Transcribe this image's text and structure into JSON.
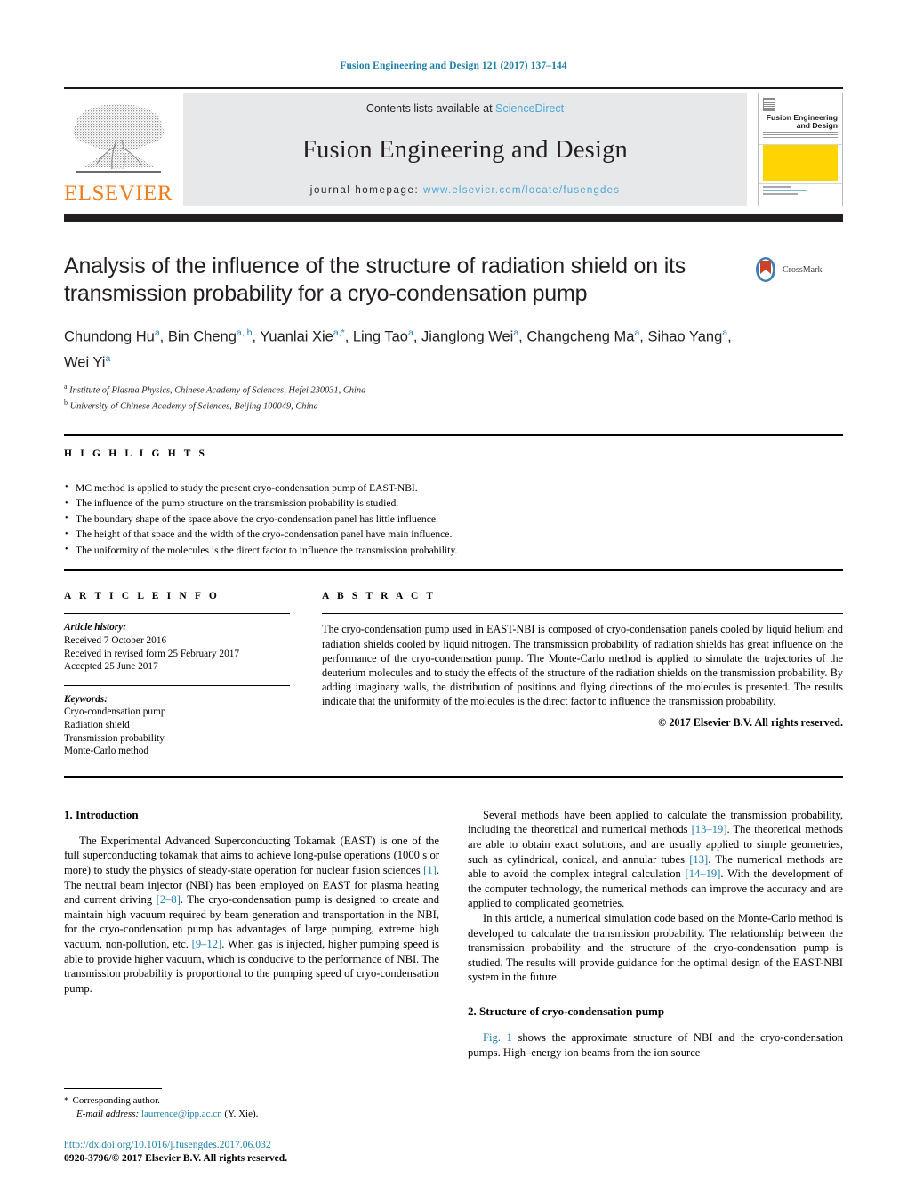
{
  "running_head": "Fusion Engineering and Design 121 (2017) 137–144",
  "masthead": {
    "publisher_logo_text": "ELSEVIER",
    "contents_prefix": "Contents lists available at ",
    "contents_link": "ScienceDirect",
    "journal_title": "Fusion Engineering and Design",
    "homepage_prefix": "journal homepage: ",
    "homepage_url": "www.elsevier.com/locate/fusengdes",
    "cover": {
      "line1": "Fusion Engineering",
      "line2": "and Design"
    },
    "accent_color": "#4aa7d8",
    "elsevier_orange": "#f07c1b",
    "band_gray": "#e7e8ea",
    "cover_yellow": "#ffd400"
  },
  "title": "Analysis of the influence of the structure of radiation shield on its transmission probability for a cryo-condensation pump",
  "crossmark_label": "CrossMark",
  "authors": "Chundong Hu<sup>a</sup>, Bin Cheng<sup>a, b</sup>, Yuanlai Xie<sup>a,*</sup>, Ling Tao<sup>a</sup>, Jianglong Wei<sup>a</sup>, Changcheng Ma<sup>a</sup>, Sihao Yang<sup>a</sup>, Wei Yi<sup>a</sup>",
  "affiliations": [
    "<sup>a</sup> Institute of Plasma Physics, Chinese Academy of Sciences, Hefei 230031, China",
    "<sup>b</sup> University of Chinese Academy of Sciences, Beijing 100049, China"
  ],
  "highlights": {
    "heading": "H I G H L I G H T S",
    "items": [
      "MC method is applied to study the present cryo-condensation pump of EAST-NBI.",
      "The influence of the pump structure on the transmission probability is studied.",
      "The boundary shape of the space above the cryo-condensation panel has little influence.",
      "The height of that space and the width of the cryo-condensation panel have main influence.",
      "The uniformity of the molecules is the direct factor to influence the transmission probability."
    ]
  },
  "article_info": {
    "heading": "A R T I C L E   I N F O",
    "history_label": "Article history:",
    "history": [
      "Received 7 October 2016",
      "Received in revised form 25 February 2017",
      "Accepted 25 June 2017"
    ],
    "keywords_label": "Keywords:",
    "keywords": [
      "Cryo-condensation pump",
      "Radiation shield",
      "Transmission probability",
      "Monte-Carlo method"
    ]
  },
  "abstract": {
    "heading": "A B S T R A C T",
    "text": "The cryo-condensation pump used in EAST-NBI is composed of cryo-condensation panels cooled by liquid helium and radiation shields cooled by liquid nitrogen. The transmission probability of radiation shields has great influence on the performance of the cryo-condensation pump. The Monte-Carlo method is applied to simulate the trajectories of the deuterium molecules and to study the effects of the structure of the radiation shields on the transmission probability. By adding imaginary walls, the distribution of positions and flying directions of the molecules is presented. The results indicate that the uniformity of the molecules is the direct factor to influence the transmission probability.",
    "copyright": "© 2017 Elsevier B.V. All rights reserved."
  },
  "sections": {
    "intro_heading": "1. Introduction",
    "intro_p1": "The Experimental Advanced Superconducting Tokamak (EAST) is one of the full superconducting tokamak that aims to achieve long-pulse operations (1000 s or more) to study the physics of steady-state operation for nuclear fusion sciences <span class=\"ref\">[1]</span>. The neutral beam injector (NBI) has been employed on EAST for plasma heating and current driving <span class=\"ref\">[2–8]</span>. The cryo-condensation pump is designed to create and maintain high vacuum required by beam generation and transportation in the NBI, for the cryo-condensation pump has advantages of large pumping, extreme high vacuum, non-pollution, etc. <span class=\"ref\">[9–12]</span>. When gas is injected, higher pumping speed is able to provide higher vacuum, which is conducive to the performance of NBI. The transmission probability is proportional to the pumping speed of cryo-condensation pump.",
    "right_p1": "Several methods have been applied to calculate the transmission probability, including the theoretical and numerical methods <span class=\"ref\">[13–19]</span>. The theoretical methods are able to obtain exact solutions, and are usually applied to simple geometries, such as cylindrical, conical, and annular tubes <span class=\"ref\">[13]</span>. The numerical methods are able to avoid the complex integral calculation <span class=\"ref\">[14–19]</span>. With the development of the computer technology, the numerical methods can improve the accuracy and are applied to complicated geometries.",
    "right_p2": "In this article, a numerical simulation code based on the Monte-Carlo method is developed to calculate the transmission probability. The relationship between the transmission probability and the structure of the cryo-condensation pump is studied. The results will provide guidance for the optimal design of the EAST-NBI system in the future.",
    "structure_heading": "2. Structure of cryo-condensation pump",
    "structure_p1": "<span class=\"ref\">Fig. 1</span> shows the approximate structure of NBI and the cryo-condensation pumps. High–energy ion beams from the ion source"
  },
  "footnote": {
    "star": "*",
    "corresponding": "Corresponding author.",
    "email_label": "E-mail address:",
    "email": "laurrence@ipp.ac.cn",
    "email_suffix": "(Y. Xie)."
  },
  "doi": {
    "url": "http://dx.doi.org/10.1016/j.fusengdes.2017.06.032",
    "issn_line": "0920-3796/© 2017 Elsevier B.V. All rights reserved."
  }
}
